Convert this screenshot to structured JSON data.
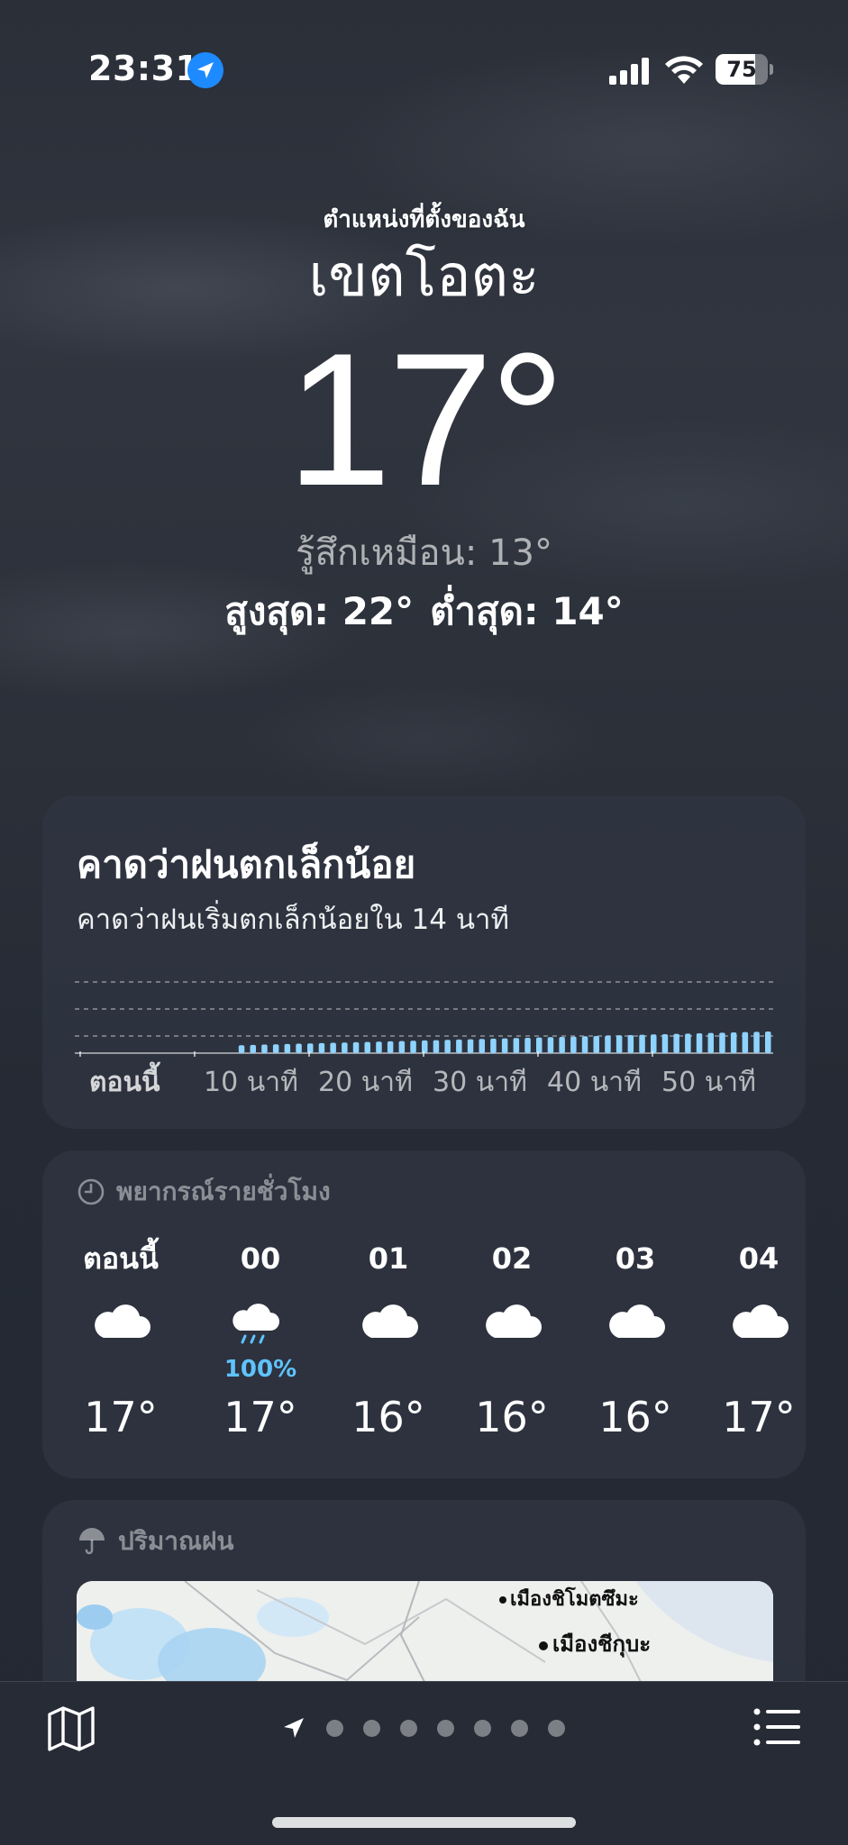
{
  "status": {
    "time": "23:31",
    "battery": "75",
    "battery_level": 0.75
  },
  "header": {
    "location_caption": "ตำแหน่งที่ตั้งของฉัน",
    "city": "เขตโอตะ",
    "temperature": "17°",
    "feels_like": "รู้สึกเหมือน: 13°",
    "high": "สูงสุด: 22°",
    "low": "ต่ำสุด: 14°"
  },
  "rain_card": {
    "title": "คาดว่าฝนตกเล็กน้อย",
    "subtitle": "คาดว่าฝนเริ่มตกเล็กน้อยใน 14 นาที",
    "ticks": [
      "ตอนนี้",
      "10 นาที",
      "20 นาที",
      "30 นาที",
      "40 นาที",
      "50 นาที"
    ],
    "bar_color": "#8fd3ff",
    "chart_data": {
      "type": "bar",
      "x_unit": "minutes",
      "start_minute": 14,
      "end_minute": 60,
      "intensity_start": 0.22,
      "intensity_end": 0.6
    }
  },
  "hourly": {
    "header": "พยากรณ์รายชั่วโมง",
    "icon": "clock-icon",
    "items": [
      {
        "time": "ตอนนี้",
        "icon": "cloud",
        "temp": "17°",
        "pop": ""
      },
      {
        "time": "00",
        "icon": "cloud-moon-rain",
        "temp": "17°",
        "pop": "100%"
      },
      {
        "time": "01",
        "icon": "cloud",
        "temp": "16°",
        "pop": ""
      },
      {
        "time": "02",
        "icon": "cloud",
        "temp": "16°",
        "pop": ""
      },
      {
        "time": "03",
        "icon": "cloud",
        "temp": "16°",
        "pop": ""
      },
      {
        "time": "04",
        "icon": "cloud",
        "temp": "17°",
        "pop": ""
      }
    ]
  },
  "precipitation": {
    "header": "ปริมาณฝน",
    "icon": "umbrella-icon",
    "map_labels": [
      "เมืองชิโมตซึมะ",
      "เมืองชีกุบะ"
    ]
  },
  "bottom_bar": {
    "page_count": 7,
    "icons": [
      "map-icon",
      "location-arrow-icon",
      "list-icon"
    ]
  }
}
